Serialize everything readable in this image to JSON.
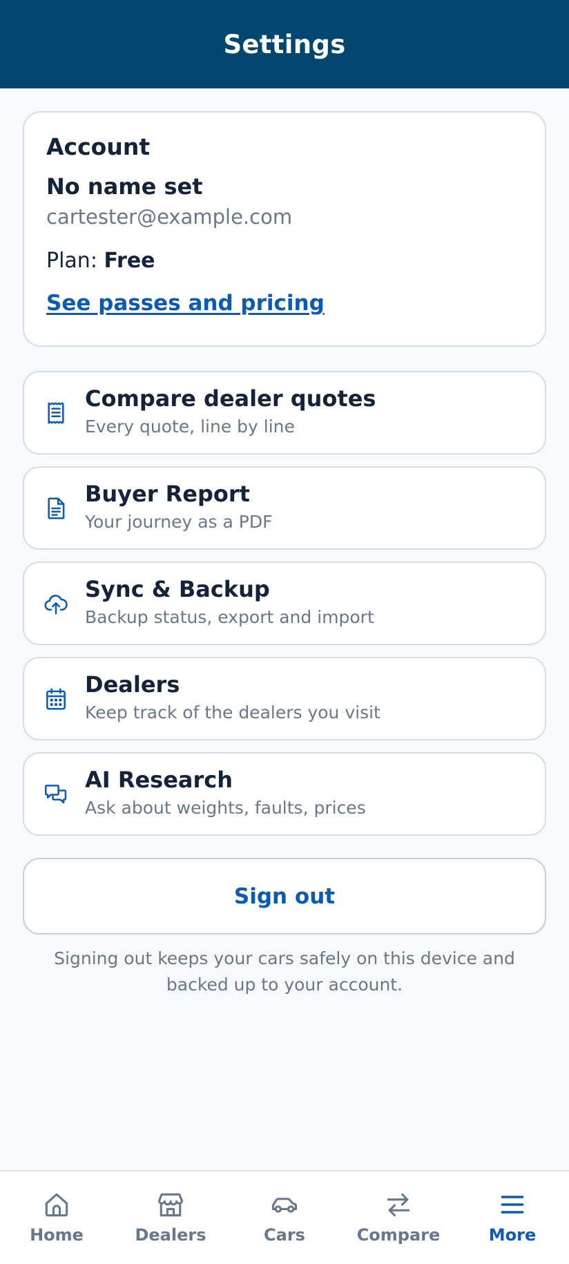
{
  "header": {
    "title": "Settings"
  },
  "account": {
    "heading": "Account",
    "name": "No name set",
    "email": "cartester@example.com",
    "plan_label": "Plan: ",
    "plan_value": "Free",
    "pricing_link": "See passes and pricing"
  },
  "menu": [
    {
      "title": "Compare dealer quotes",
      "subtitle": "Every quote, line by line",
      "icon": "receipt-icon"
    },
    {
      "title": "Buyer Report",
      "subtitle": "Your journey as a PDF",
      "icon": "document-icon"
    },
    {
      "title": "Sync & Backup",
      "subtitle": "Backup status, export and import",
      "icon": "cloud-upload-icon"
    },
    {
      "title": "Dealers",
      "subtitle": "Keep track of the dealers you visit",
      "icon": "calendar-icon"
    },
    {
      "title": "AI Research",
      "subtitle": "Ask about weights, faults, prices",
      "icon": "chat-bubbles-icon"
    }
  ],
  "signout": {
    "label": "Sign out",
    "note": "Signing out keeps your cars safely on this device and backed up to your account."
  },
  "tabbar": {
    "active": "More",
    "items": [
      {
        "label": "Home",
        "icon": "home-icon"
      },
      {
        "label": "Dealers",
        "icon": "storefront-icon"
      },
      {
        "label": "Cars",
        "icon": "car-icon"
      },
      {
        "label": "Compare",
        "icon": "arrows-swap-icon"
      },
      {
        "label": "More",
        "icon": "menu-icon"
      }
    ]
  },
  "colors": {
    "header_bg": "#00466f",
    "accent": "#0c5bb0",
    "text_primary": "#13233a",
    "text_secondary": "#67788c",
    "page_bg": "#f7f9fb"
  }
}
